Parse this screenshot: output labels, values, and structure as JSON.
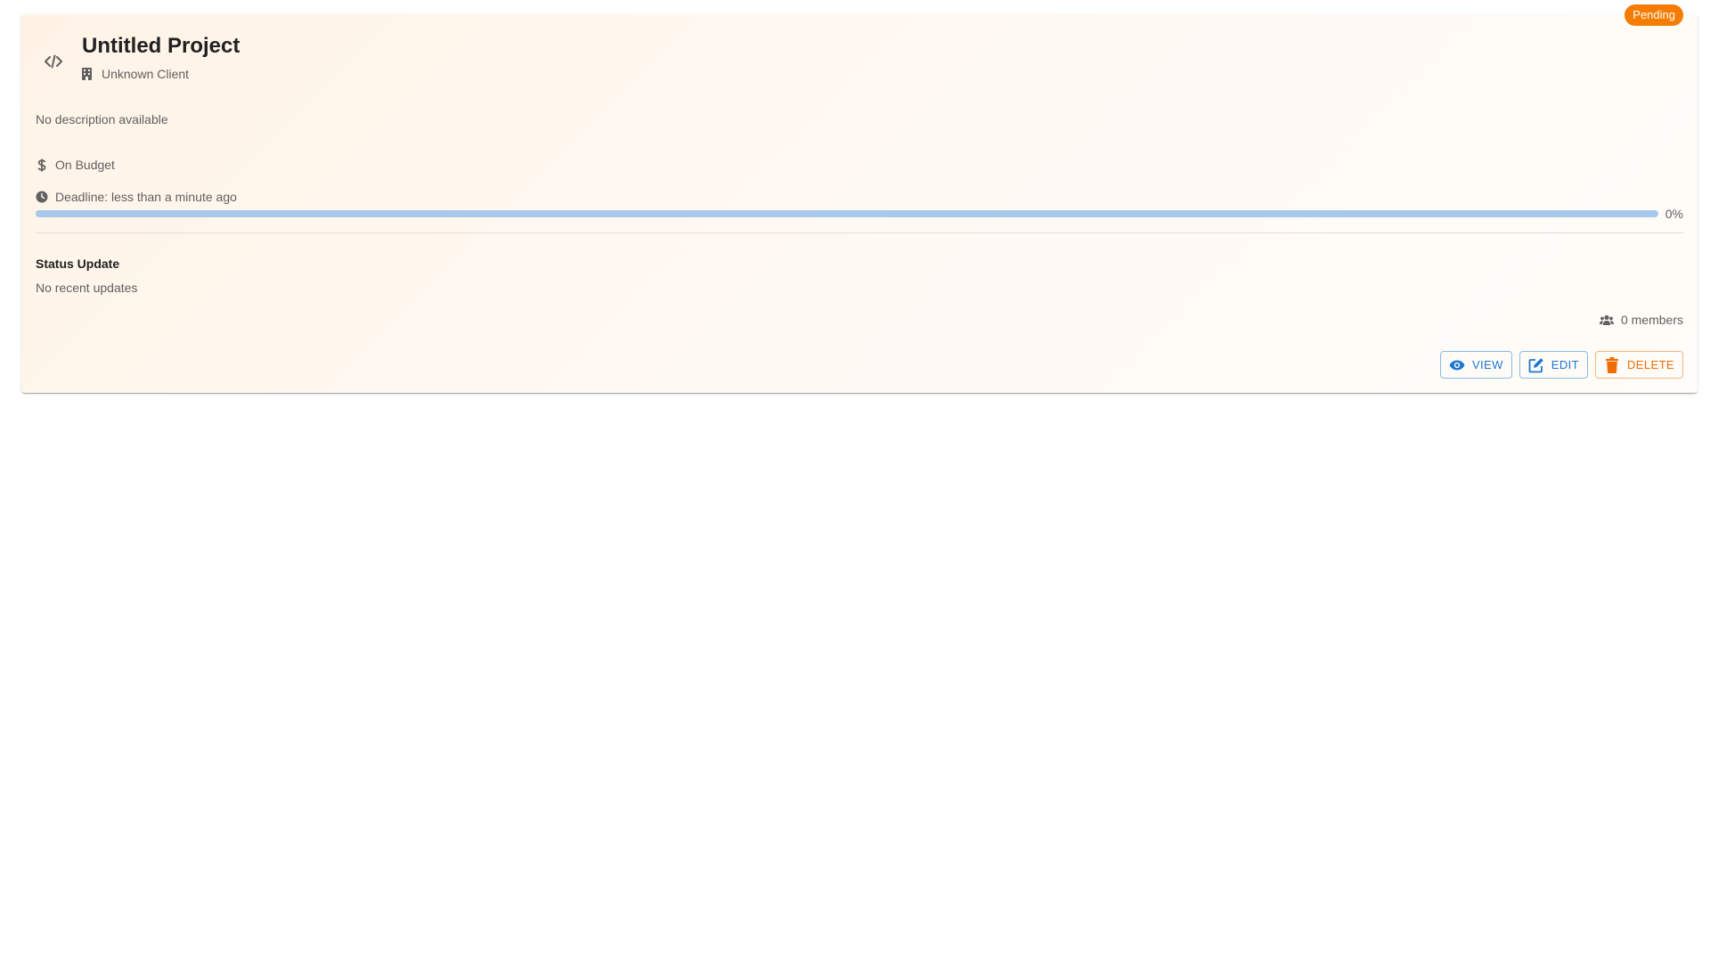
{
  "project": {
    "title": "Untitled Project",
    "client": "Unknown Client",
    "status": "Pending",
    "description": "No description available",
    "budget_status": "On Budget",
    "deadline": "Deadline: less than a minute ago",
    "progress": 0,
    "progress_label": "0%",
    "status_update_title": "Status Update",
    "status_update_text": "No recent updates",
    "members": "0 members"
  },
  "icons": {
    "project_type": "code-icon",
    "client": "building-icon",
    "budget": "dollar-icon",
    "deadline": "clock-icon",
    "members": "users-icon",
    "view": "eye-icon",
    "edit": "edit-icon",
    "delete": "trash-icon"
  },
  "actions": {
    "view": "VIEW",
    "edit": "EDIT",
    "delete": "DELETE"
  },
  "colors": {
    "status_badge": "#f57c00",
    "primary": "#1976d2",
    "warning": "#ef6c00"
  }
}
